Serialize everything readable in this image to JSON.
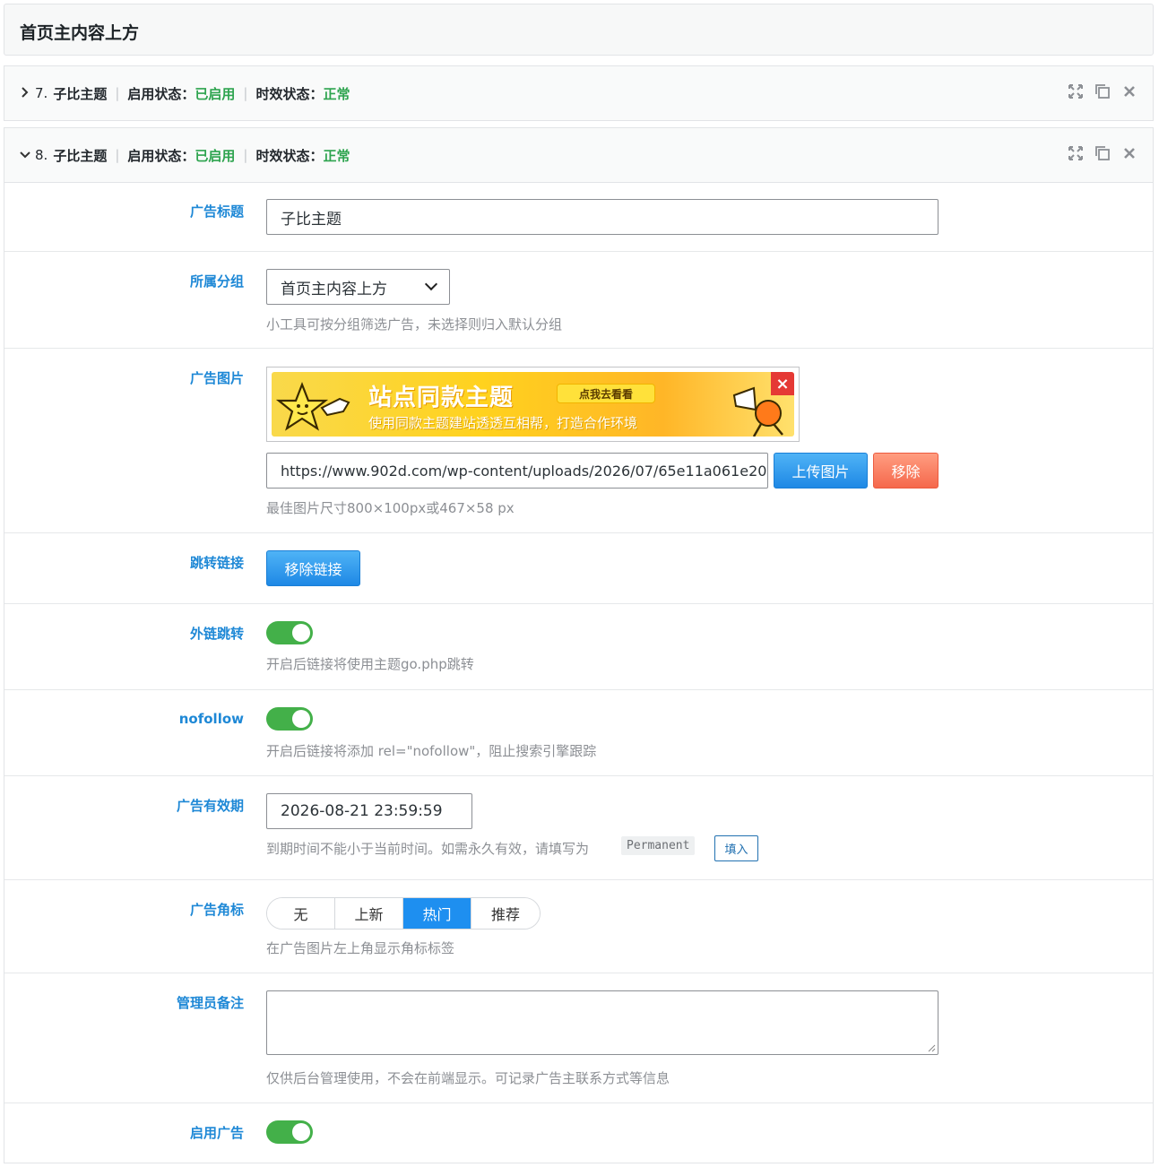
{
  "section": {
    "title": "首页主内容上方"
  },
  "items": [
    {
      "num": "7.",
      "name": "子比主题",
      "enable_label": "启用状态：",
      "enable_value": "已启用",
      "expire_label": "时效状态：",
      "expire_value": "正常",
      "expanded": false
    },
    {
      "num": "8.",
      "name": "子比主题",
      "enable_label": "启用状态：",
      "enable_value": "已启用",
      "expire_label": "时效状态：",
      "expire_value": "正常",
      "expanded": true
    }
  ],
  "form": {
    "ad_title": {
      "label": "广告标题",
      "value": "子比主题"
    },
    "group": {
      "label": "所属分组",
      "value": "首页主内容上方",
      "desc": "小工具可按分组筛选广告，未选择则归入默认分组"
    },
    "image": {
      "label": "广告图片",
      "url": "https://www.902d.com/wp-content/uploads/2026/07/65e11a061e20",
      "upload_btn": "上传图片",
      "remove_btn": "移除",
      "desc": "最佳图片尺寸800×100px或467×58 px",
      "banner_title": "站点同款主题",
      "banner_cta": "点我去看看",
      "banner_sub": "使用同款主题建站透透互相帮，打造合作环境"
    },
    "link": {
      "label": "跳转链接",
      "remove_btn": "移除链接"
    },
    "external": {
      "label": "外链跳转",
      "desc": "开启后链接将使用主题go.php跳转",
      "on": true
    },
    "nofollow": {
      "label": "nofollow",
      "desc": "开启后链接将添加 rel=\"nofollow\"，阻止搜索引擎跟踪",
      "on": true
    },
    "expiry": {
      "label": "广告有效期",
      "value": "2026-08-21 23:59:59",
      "desc": "到期时间不能小于当前时间。如需永久有效，请填写为",
      "code": "Permanent",
      "fill_btn": "填入"
    },
    "badge": {
      "label": "广告角标",
      "options": [
        "无",
        "上新",
        "热门",
        "推荐"
      ],
      "selected": "热门",
      "desc": "在广告图片左上角显示角标标签"
    },
    "note": {
      "label": "管理员备注",
      "value": "",
      "desc": "仅供后台管理使用，不会在前端显示。可记录广告主联系方式等信息"
    },
    "enable": {
      "label": "启用广告",
      "on": true
    }
  },
  "colors": {
    "label_blue": "#1e88d6",
    "status_green": "#2ea44f",
    "toggle_green": "#43b049",
    "segment_active": "#1e8ff0"
  }
}
